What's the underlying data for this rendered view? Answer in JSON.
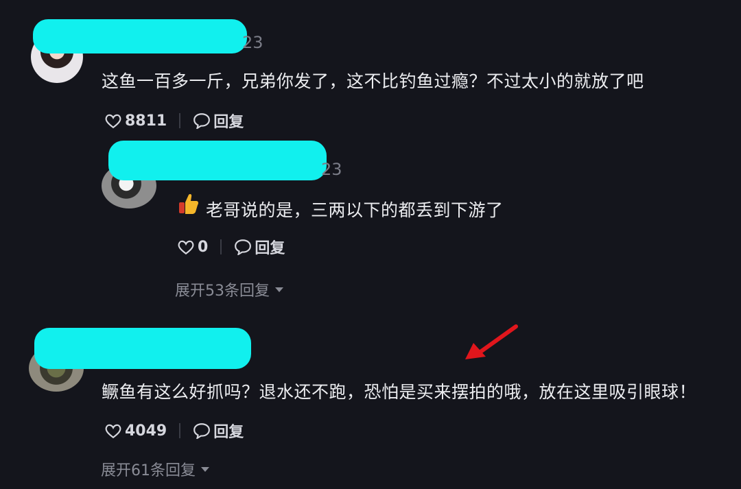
{
  "comments": [
    {
      "timestamp_suffix": "23",
      "text": "这鱼一百多一斤，兄弟你发了，这不比钓鱼过瘾？不过太小的就放了吧",
      "likes": "8811",
      "reply_label": "回复"
    },
    {
      "timestamp_suffix": "23",
      "text": "老哥说的是，三两以下的都丢到下游了",
      "likes": "0",
      "reply_label": "回复",
      "expand_label": "展开53条回复"
    },
    {
      "text": "鳜鱼有这么好抓吗？退水还不跑，恐怕是买来摆拍的哦，放在这里吸引眼球！",
      "likes": "4049",
      "reply_label": "回复",
      "expand_label": "展开61条回复"
    }
  ],
  "colors": {
    "background": "#14151c",
    "redaction": "#11f0ee",
    "annotation_arrow": "#e0161c"
  },
  "icons": [
    "heart-outline-icon",
    "comment-bubble-icon",
    "thumbs-up-emoji-icon",
    "caret-down-icon",
    "red-arrow-annotation"
  ]
}
